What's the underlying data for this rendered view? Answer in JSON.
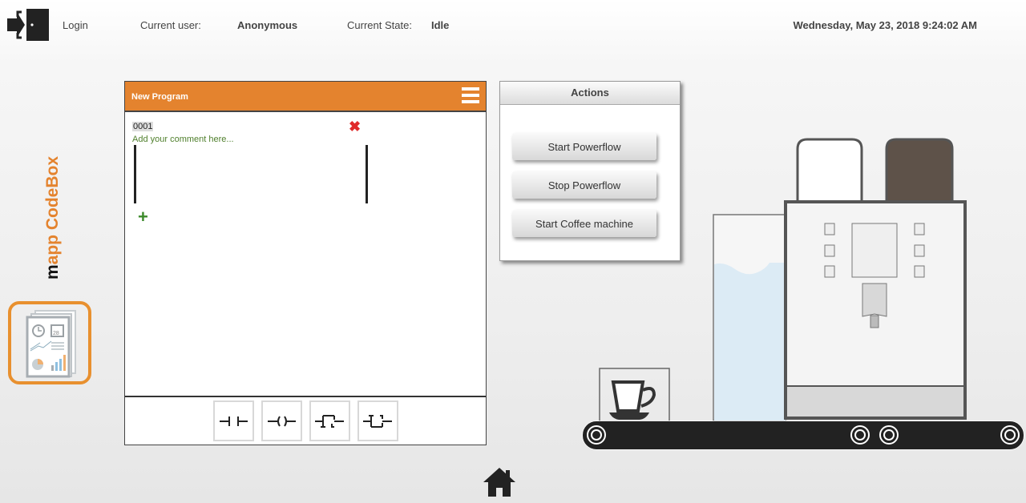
{
  "header": {
    "login_label": "Login",
    "current_user_label": "Current user:",
    "current_user": "Anonymous",
    "current_state_label": "Current State:",
    "current_state": "Idle",
    "datetime": "Wednesday, May 23, 2018 9:24:02 AM"
  },
  "sidebar": {
    "logo_text": "mapp CodeBox",
    "app_icon": "report-dashboard-icon"
  },
  "program": {
    "title": "New Program",
    "network_number": "0001",
    "comment_placeholder": "Add your comment here...",
    "toolbox": [
      "contact-no-icon",
      "coil-icon",
      "contact-positive-edge-icon",
      "contact-negative-edge-icon"
    ]
  },
  "actions": {
    "title": "Actions",
    "buttons": [
      "Start Powerflow",
      "Stop Powerflow",
      "Start Coffee machine"
    ]
  },
  "colors": {
    "accent": "#e4832e",
    "delete": "#e02b2b",
    "add": "#3c8a2a",
    "water": "#dcebf5",
    "coffee_hopper": "#5e5249"
  }
}
